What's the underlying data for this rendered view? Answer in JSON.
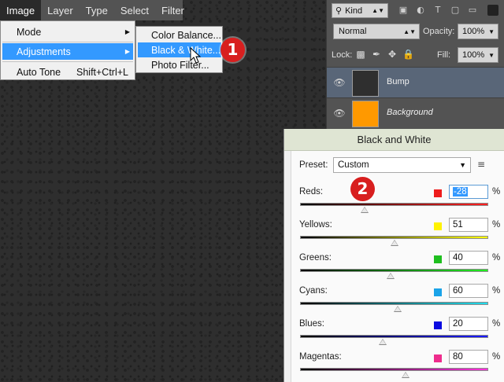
{
  "menubar": {
    "items": [
      {
        "label": "Image",
        "active": true
      },
      {
        "label": "Layer"
      },
      {
        "label": "Type"
      },
      {
        "label": "Select"
      },
      {
        "label": "Filter"
      }
    ]
  },
  "image_menu": {
    "mode": "Mode",
    "adjustments": "Adjustments",
    "auto_tone": "Auto Tone",
    "auto_tone_shortcut": "Shift+Ctrl+L"
  },
  "adjustments_submenu": {
    "items": [
      "Color Balance...",
      "Black & White...",
      "Photo Filter..."
    ],
    "highlighted": "Black & White..."
  },
  "callouts": [
    "1",
    "2"
  ],
  "layers_panel": {
    "filter_kind": "Kind",
    "blend_mode": "Normal",
    "opacity_label": "Opacity:",
    "opacity": "100%",
    "lock_label": "Lock:",
    "fill_label": "Fill:",
    "fill": "100%",
    "layers": [
      {
        "name": "Bump",
        "selected": true,
        "thumb_color": "#2f2f2f"
      },
      {
        "name": "Background",
        "selected": false,
        "thumb_color": "#ff9900"
      }
    ]
  },
  "bw_dialog": {
    "title": "Black and White",
    "preset_label": "Preset:",
    "preset_value": "Custom",
    "channels": [
      {
        "name": "Reds:",
        "value": "-28",
        "swatch": "#ee1c1c",
        "gradient": [
          "#000000",
          "#ff2020"
        ],
        "focused": true,
        "min": -200,
        "max": 300
      },
      {
        "name": "Yellows:",
        "value": "51",
        "swatch": "#fff200",
        "gradient": [
          "#000000",
          "#ffff00"
        ],
        "min": -200,
        "max": 300
      },
      {
        "name": "Greens:",
        "value": "40",
        "swatch": "#1fbf1f",
        "gradient": [
          "#000000",
          "#22ee22"
        ],
        "min": -200,
        "max": 300
      },
      {
        "name": "Cyans:",
        "value": "60",
        "swatch": "#1aa3e8",
        "gradient": [
          "#000000",
          "#22ddee"
        ],
        "min": -200,
        "max": 300
      },
      {
        "name": "Blues:",
        "value": "20",
        "swatch": "#0a0ae0",
        "gradient": [
          "#000000",
          "#1a1aff"
        ],
        "min": -200,
        "max": 300
      },
      {
        "name": "Magentas:",
        "value": "80",
        "swatch": "#ee2c8c",
        "gradient": [
          "#000000",
          "#ff33dd"
        ],
        "min": -200,
        "max": 300
      }
    ],
    "percent": "%"
  }
}
